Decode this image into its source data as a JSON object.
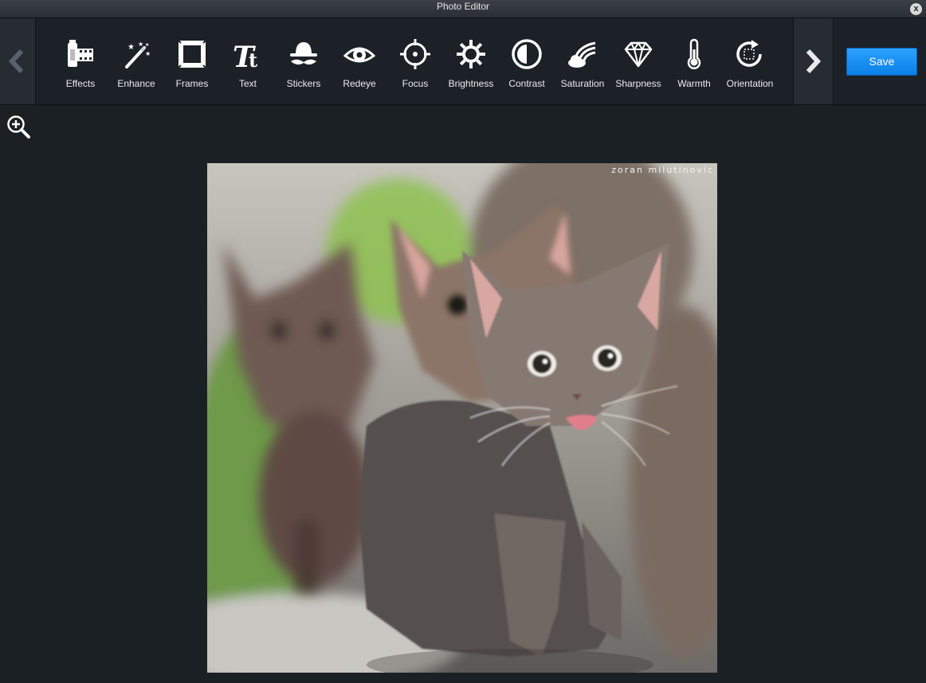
{
  "window": {
    "title": "Photo Editor",
    "close_glyph": "x"
  },
  "toolbar": {
    "prev_icon": "chevron-left-icon",
    "next_icon": "chevron-right-icon",
    "tools": [
      {
        "label": "Effects",
        "icon": "film-roll-icon"
      },
      {
        "label": "Enhance",
        "icon": "magic-wand-icon"
      },
      {
        "label": "Frames",
        "icon": "frame-icon"
      },
      {
        "label": "Text",
        "icon": "text-tt-icon"
      },
      {
        "label": "Stickers",
        "icon": "hat-mustache-icon"
      },
      {
        "label": "Redeye",
        "icon": "eye-icon"
      },
      {
        "label": "Focus",
        "icon": "crosshair-icon"
      },
      {
        "label": "Brightness",
        "icon": "sun-icon"
      },
      {
        "label": "Contrast",
        "icon": "contrast-circle-icon"
      },
      {
        "label": "Saturation",
        "icon": "rainbow-cloud-icon"
      },
      {
        "label": "Sharpness",
        "icon": "diamond-icon"
      },
      {
        "label": "Warmth",
        "icon": "thermometer-icon"
      },
      {
        "label": "Orientation",
        "icon": "rotate-icon"
      }
    ],
    "save_label": "Save"
  },
  "canvas": {
    "zoom_icon": "zoom-in-icon",
    "photo_subject": "three kittens",
    "watermark": "zoran milutinovic"
  },
  "colors": {
    "background": "#1b2025",
    "toolbar": "#1c2127",
    "accent": "#1a90f5"
  }
}
